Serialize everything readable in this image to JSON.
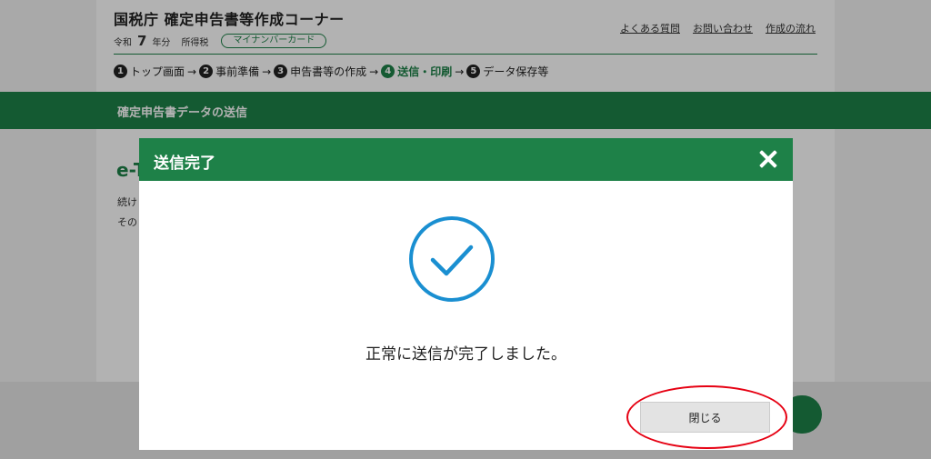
{
  "header": {
    "site_title": "国税庁 確定申告書等作成コーナー",
    "era": "令和",
    "year": "7",
    "year_suffix": "年分",
    "tax_type": "所得税",
    "mynumber_badge": "マイナンバーカード",
    "links": [
      "よくある質問",
      "お問い合わせ",
      "作成の流れ"
    ]
  },
  "steps": [
    {
      "num": "1",
      "label": "トップ画面"
    },
    {
      "num": "2",
      "label": "事前準備"
    },
    {
      "num": "3",
      "label": "申告書等の作成"
    },
    {
      "num": "4",
      "label": "送信・印刷"
    },
    {
      "num": "5",
      "label": "データ保存等"
    }
  ],
  "steps_current": 4,
  "band_title": "確定申告書データの送信",
  "content": {
    "heading_partial": "e-T",
    "line1_partial": "続け",
    "line2_partial": "その"
  },
  "modal": {
    "title": "送信完了",
    "message": "正常に送信が完了しました。",
    "close_button_label": "閉じる"
  },
  "colors": {
    "brand_green": "#1e8148",
    "check_blue": "#1a8fd1",
    "highlight_red": "#e60012"
  },
  "icons": {
    "close": "close-icon",
    "success": "check-circle-icon"
  }
}
